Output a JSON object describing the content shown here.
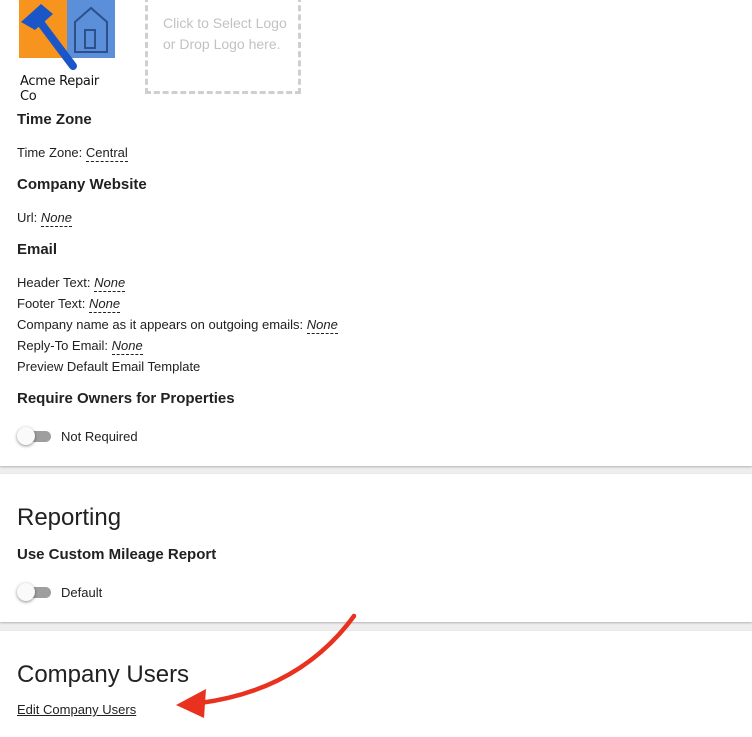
{
  "logo": {
    "text": "Acme Repair Co",
    "icon": "hammer-house-logo"
  },
  "logo_dropzone": {
    "line1": "Click to Select Logo",
    "line2": "or Drop Logo here."
  },
  "time_zone": {
    "heading": "Time Zone",
    "label": "Time Zone:",
    "value": "Central"
  },
  "website": {
    "heading": "Company Website",
    "label": "Url:",
    "value": "None"
  },
  "email": {
    "heading": "Email",
    "header_label": "Header Text:",
    "header_value": "None",
    "footer_label": "Footer Text:",
    "footer_value": "None",
    "company_name_label": "Company name as it appears on outgoing emails:",
    "company_name_value": "None",
    "reply_to_label": "Reply-To Email:",
    "reply_to_value": "None",
    "preview_label": "Preview Default Email Template"
  },
  "owners": {
    "heading": "Require Owners for Properties",
    "toggle_label": "Not Required",
    "toggle_on": false
  },
  "reporting": {
    "title": "Reporting",
    "mileage_heading": "Use Custom Mileage Report",
    "toggle_label": "Default",
    "toggle_on": false
  },
  "users": {
    "title": "Company Users",
    "edit_link": "Edit Company Users"
  },
  "colors": {
    "annotation_arrow": "#e8321f",
    "logo_orange": "#f7941d",
    "logo_blue": "#5b8fd9",
    "hammer_blue": "#1b56c9"
  }
}
